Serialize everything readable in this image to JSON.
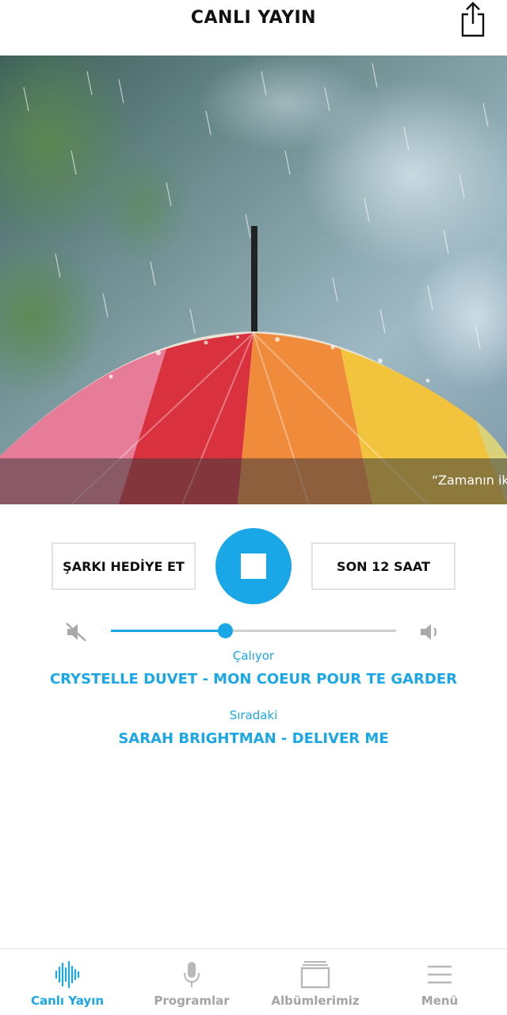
{
  "header": {
    "title": "CANLI YAYIN",
    "share_icon": "share-icon"
  },
  "hero": {
    "image_description_icon": "rainbow-umbrella-in-rain-image",
    "ticker_text": "“Zamanın iki"
  },
  "player": {
    "gift_song_label": "ŞARKI HEDİYE ET",
    "last12_label": "SON 12 SAAT",
    "stop_icon": "stop-icon",
    "volume_level": 0.4,
    "mute_icon": "volume-mute-icon",
    "volume_up_icon": "volume-up-icon",
    "now_playing_label": "Çalıyor",
    "now_playing_song": "CRYSTELLE DUVET - MON COEUR POUR TE GARDER",
    "next_label": "Sıradaki",
    "next_song": "SARAH BRIGHTMAN - DELIVER ME"
  },
  "tabs": [
    {
      "label": "Canlı Yayın",
      "icon": "waveform-icon",
      "active": true
    },
    {
      "label": "Programlar",
      "icon": "microphone-icon",
      "active": false
    },
    {
      "label": "Albümlerimiz",
      "icon": "albums-icon",
      "active": false
    },
    {
      "label": "Menü",
      "icon": "hamburger-menu-icon",
      "active": false
    }
  ],
  "colors": {
    "accent": "#1aa7e8",
    "inactive": "#a4a4a4"
  }
}
